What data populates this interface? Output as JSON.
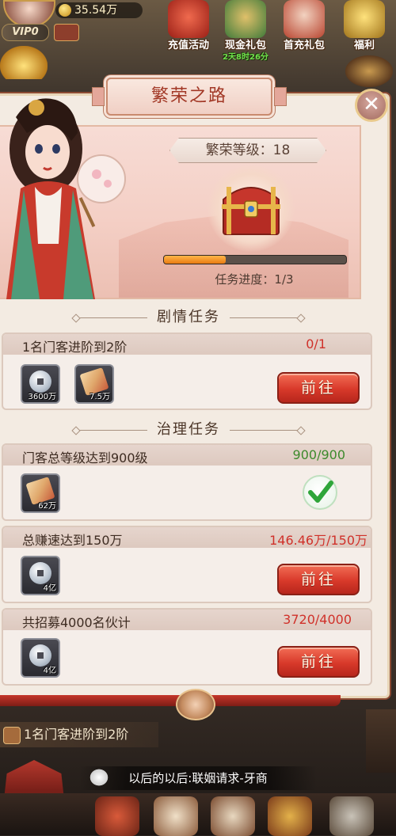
{
  "top": {
    "coins": "35.54万",
    "vip": "VIP0",
    "icons": [
      {
        "label": "充值活动",
        "color": "#c2372a"
      },
      {
        "label": "现金礼包",
        "color": "#3f7a3a",
        "timer": "2天8时26分"
      },
      {
        "label": "首充礼包",
        "color": "#b8442f"
      },
      {
        "label": "福利",
        "color": "#c99a2a"
      }
    ]
  },
  "panel": {
    "title": "繁荣之路",
    "close": "✕",
    "level_text": "繁荣等级：18",
    "progress_fraction": 0.34,
    "progress_text": "任务进度：1/3"
  },
  "sections": {
    "story": "剧情任务",
    "govern": "治理任务"
  },
  "tasks": [
    {
      "name": "1名门客进阶到2阶",
      "progress": "0/1",
      "progress_color": "#d0312a",
      "rewards": [
        {
          "icon": "silver-coin-icon",
          "amount": "3600万"
        },
        {
          "icon": "scroll-icon",
          "amount": "7.5万"
        }
      ],
      "button": "前往"
    },
    {
      "name": "门客总等级达到900级",
      "progress": "900/900",
      "progress_color": "#3d8a2c",
      "rewards": [
        {
          "icon": "scroll-icon",
          "amount": "62万"
        }
      ],
      "completed_icon": "check-icon"
    },
    {
      "name": "总赚速达到150万",
      "progress": "146.46万/150万",
      "progress_color": "#d0312a",
      "rewards": [
        {
          "icon": "silver-coin-icon",
          "amount": "4亿"
        }
      ],
      "button": "前往"
    },
    {
      "name": "共招募4000名伙计",
      "progress": "3720/4000",
      "progress_color": "#d0312a",
      "rewards": [
        {
          "icon": "silver-coin-icon",
          "amount": "4亿"
        }
      ],
      "button": "前往"
    }
  ],
  "below": {
    "quest_strip": "1名门客进阶到2阶",
    "news": "以后的以后:联姻请求-牙商"
  }
}
